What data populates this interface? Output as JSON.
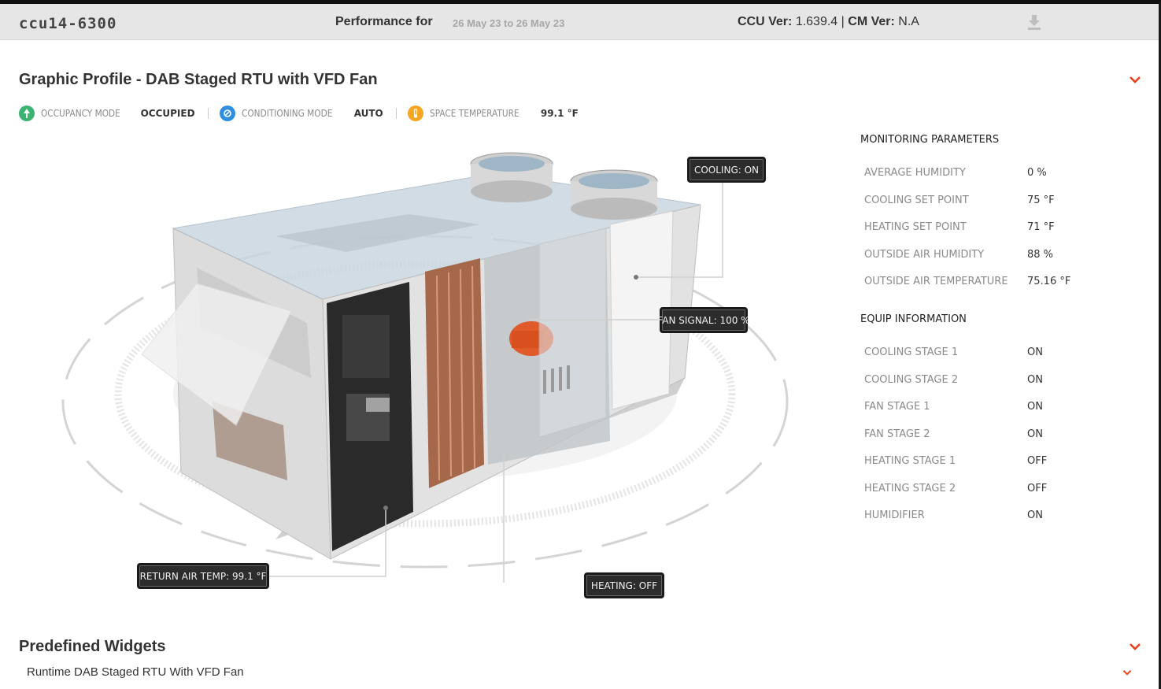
{
  "header": {
    "site_name": "ccu14-6300",
    "performance_label": "Performance for",
    "date_range": "26 May 23 to 26 May 23",
    "ccu_label": "CCU Ver:",
    "ccu_version": "1.639.4",
    "separator": "|",
    "cm_label": "CM Ver:",
    "cm_version": "N.A",
    "download_icon": "download-icon"
  },
  "graphic_profile": {
    "title": "Graphic Profile - DAB Staged RTU with VFD Fan",
    "status": [
      {
        "icon": "occupancy-icon",
        "color": "#3cb371",
        "label": "OCCUPANCY MODE",
        "value": "OCCUPIED"
      },
      {
        "icon": "conditioning-icon",
        "color": "#2f8fde",
        "label": "CONDITIONING MODE",
        "value": "AUTO"
      },
      {
        "icon": "temperature-icon",
        "color": "#f5a623",
        "label": "SPACE TEMPERATURE",
        "value": "99.1 °F"
      }
    ],
    "callouts": {
      "cooling": "COOLING: ON",
      "fan_signal": "FAN SIGNAL: 100 %",
      "return_air": "RETURN AIR TEMP: 99.1 °F",
      "heating": "HEATING: OFF"
    }
  },
  "monitoring": {
    "title": "MONITORING PARAMETERS",
    "rows": [
      {
        "label": "AVERAGE HUMIDITY",
        "value": "0 %"
      },
      {
        "label": "COOLING SET POINT",
        "value": "75 °F"
      },
      {
        "label": "HEATING SET POINT",
        "value": "71 °F"
      },
      {
        "label": "OUTSIDE AIR HUMIDITY",
        "value": "88 %"
      },
      {
        "label": "OUTSIDE AIR TEMPERATURE",
        "value": "75.16 °F"
      }
    ]
  },
  "equip": {
    "title": "EQUIP INFORMATION",
    "rows": [
      {
        "label": "COOLING STAGE 1",
        "value": "ON"
      },
      {
        "label": "COOLING STAGE 2",
        "value": "ON"
      },
      {
        "label": "FAN STAGE 1",
        "value": "ON"
      },
      {
        "label": "FAN STAGE 2",
        "value": "ON"
      },
      {
        "label": "HEATING STAGE 1",
        "value": "OFF"
      },
      {
        "label": "HEATING STAGE 2",
        "value": "OFF"
      },
      {
        "label": "HUMIDIFIER",
        "value": "ON"
      }
    ]
  },
  "predefined": {
    "title": "Predefined Widgets",
    "widget_label": "Runtime DAB Staged RTU With VFD Fan"
  },
  "colors": {
    "accent": "#e8431e",
    "header_bg": "#e6e6e6",
    "callout_bg": "#2c2c2c"
  }
}
